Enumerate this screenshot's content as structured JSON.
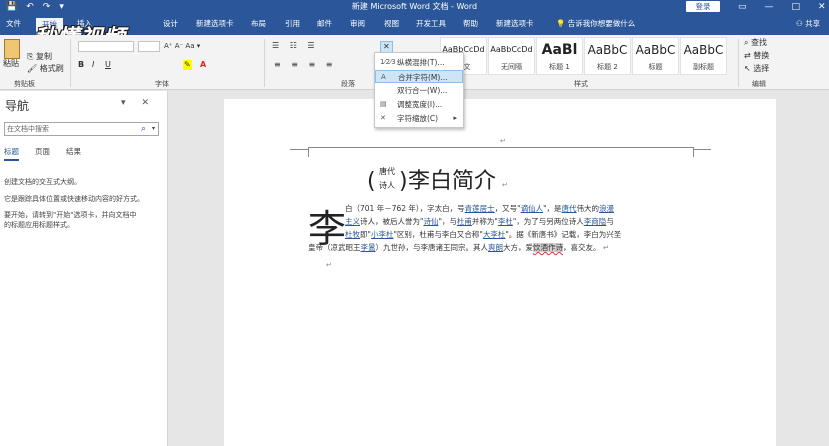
{
  "titlebar": {
    "title": "新建 Microsoft Word 文档 - Word",
    "login": "登录",
    "qat": [
      "💾",
      "↶",
      "↷",
      "▾"
    ],
    "controls": [
      "▭",
      "—",
      "□",
      "✕"
    ]
  },
  "tabs": [
    "文件",
    "开始",
    "插入",
    "设计",
    "新建选项卡",
    "布局",
    "引用",
    "邮件",
    "审阅",
    "视图",
    "开发工具",
    "帮助",
    "新建选项卡"
  ],
  "tellme": "告诉我你想要做什么",
  "share": "共享",
  "logo": "秒懂视频",
  "ribbon": {
    "paste": "粘贴",
    "copy": "复制",
    "format_painter": "格式刷",
    "clipboard_label": "剪贴板",
    "font_label": "字体",
    "font_size_options": "A⁺  A⁻  Aa ▾",
    "bold": "B",
    "italic": "I",
    "underline": "U",
    "paragraph_label": "段落",
    "style_label": "样式",
    "find": "查找",
    "replace": "替换",
    "select": "选择",
    "edit_label": "编辑"
  },
  "styles": [
    {
      "sample": "AaBbCcDd",
      "name": "正文"
    },
    {
      "sample": "AaBbCcDd",
      "name": "无间隔"
    },
    {
      "sample": "AaBl",
      "name": "标题 1"
    },
    {
      "sample": "AaBbC",
      "name": "标题 2"
    },
    {
      "sample": "AaBbC",
      "name": "标题"
    },
    {
      "sample": "AaBbC",
      "name": "副标题"
    }
  ],
  "menu": [
    {
      "icon": "1⁄2⁄3",
      "label": "纵横混排(T)..."
    },
    {
      "icon": "A",
      "label": "合并字符(M)..."
    },
    {
      "icon": "",
      "label": "双行合一(W)..."
    },
    {
      "icon": "▤",
      "label": "调整宽度(I)..."
    },
    {
      "icon": "✕",
      "label": "字符缩放(C)"
    }
  ],
  "nav": {
    "title": "导航",
    "search_placeholder": "在文档中搜索",
    "tabs": [
      "标题",
      "页面",
      "结果"
    ],
    "p1": "创建文档的交互式大纲。",
    "p2": "它是跟踪具体位置或快速移动内容的好方式。",
    "p3a": "要开始，请转到\"开始\"选项卡，并向文档中",
    "p3b": "的标题应用标题样式。"
  },
  "doc": {
    "ruby_base": "诗人",
    "ruby_text": "唐代",
    "title": "李白简介",
    "big_char": "李",
    "line1_a": "白（701 年－762 年），字太白，号",
    "line1_l1": "青莲居士",
    "line1_b": "，又号\"",
    "line1_l2": "谪仙人",
    "line1_c": "\"，是",
    "line1_l3": "唐代",
    "line1_d": "伟大的",
    "line1_l4": "浪漫",
    "line2_l1": "主义",
    "line2_a": "诗人，被后人誉为\"",
    "line2_l2": "诗仙",
    "line2_b": "\"，与",
    "line2_l3": "杜甫",
    "line2_c": "并称为\"",
    "line2_l4": "李杜",
    "line2_d": "\"，为了与另两位诗人",
    "line2_l5": "李商隐",
    "line2_e": "与",
    "line3_l1": "杜牧",
    "line3_a": "即\"",
    "line3_l2": "小李杜",
    "line3_b": "\"区别，杜甫与李白又合称\"",
    "line3_l3": "大李杜",
    "line3_c": "\"。据《新唐书》记载，李白为兴圣",
    "line4_a": "皇帝（凉武昭王",
    "line4_l1": "李暠",
    "line4_b": "）九世孙，与李唐诸王同宗。其人",
    "line4_l2": "爽朗",
    "line4_c": "大方，爱",
    "line4_h": "饮酒作诗",
    "line4_d": "，喜交友。"
  }
}
